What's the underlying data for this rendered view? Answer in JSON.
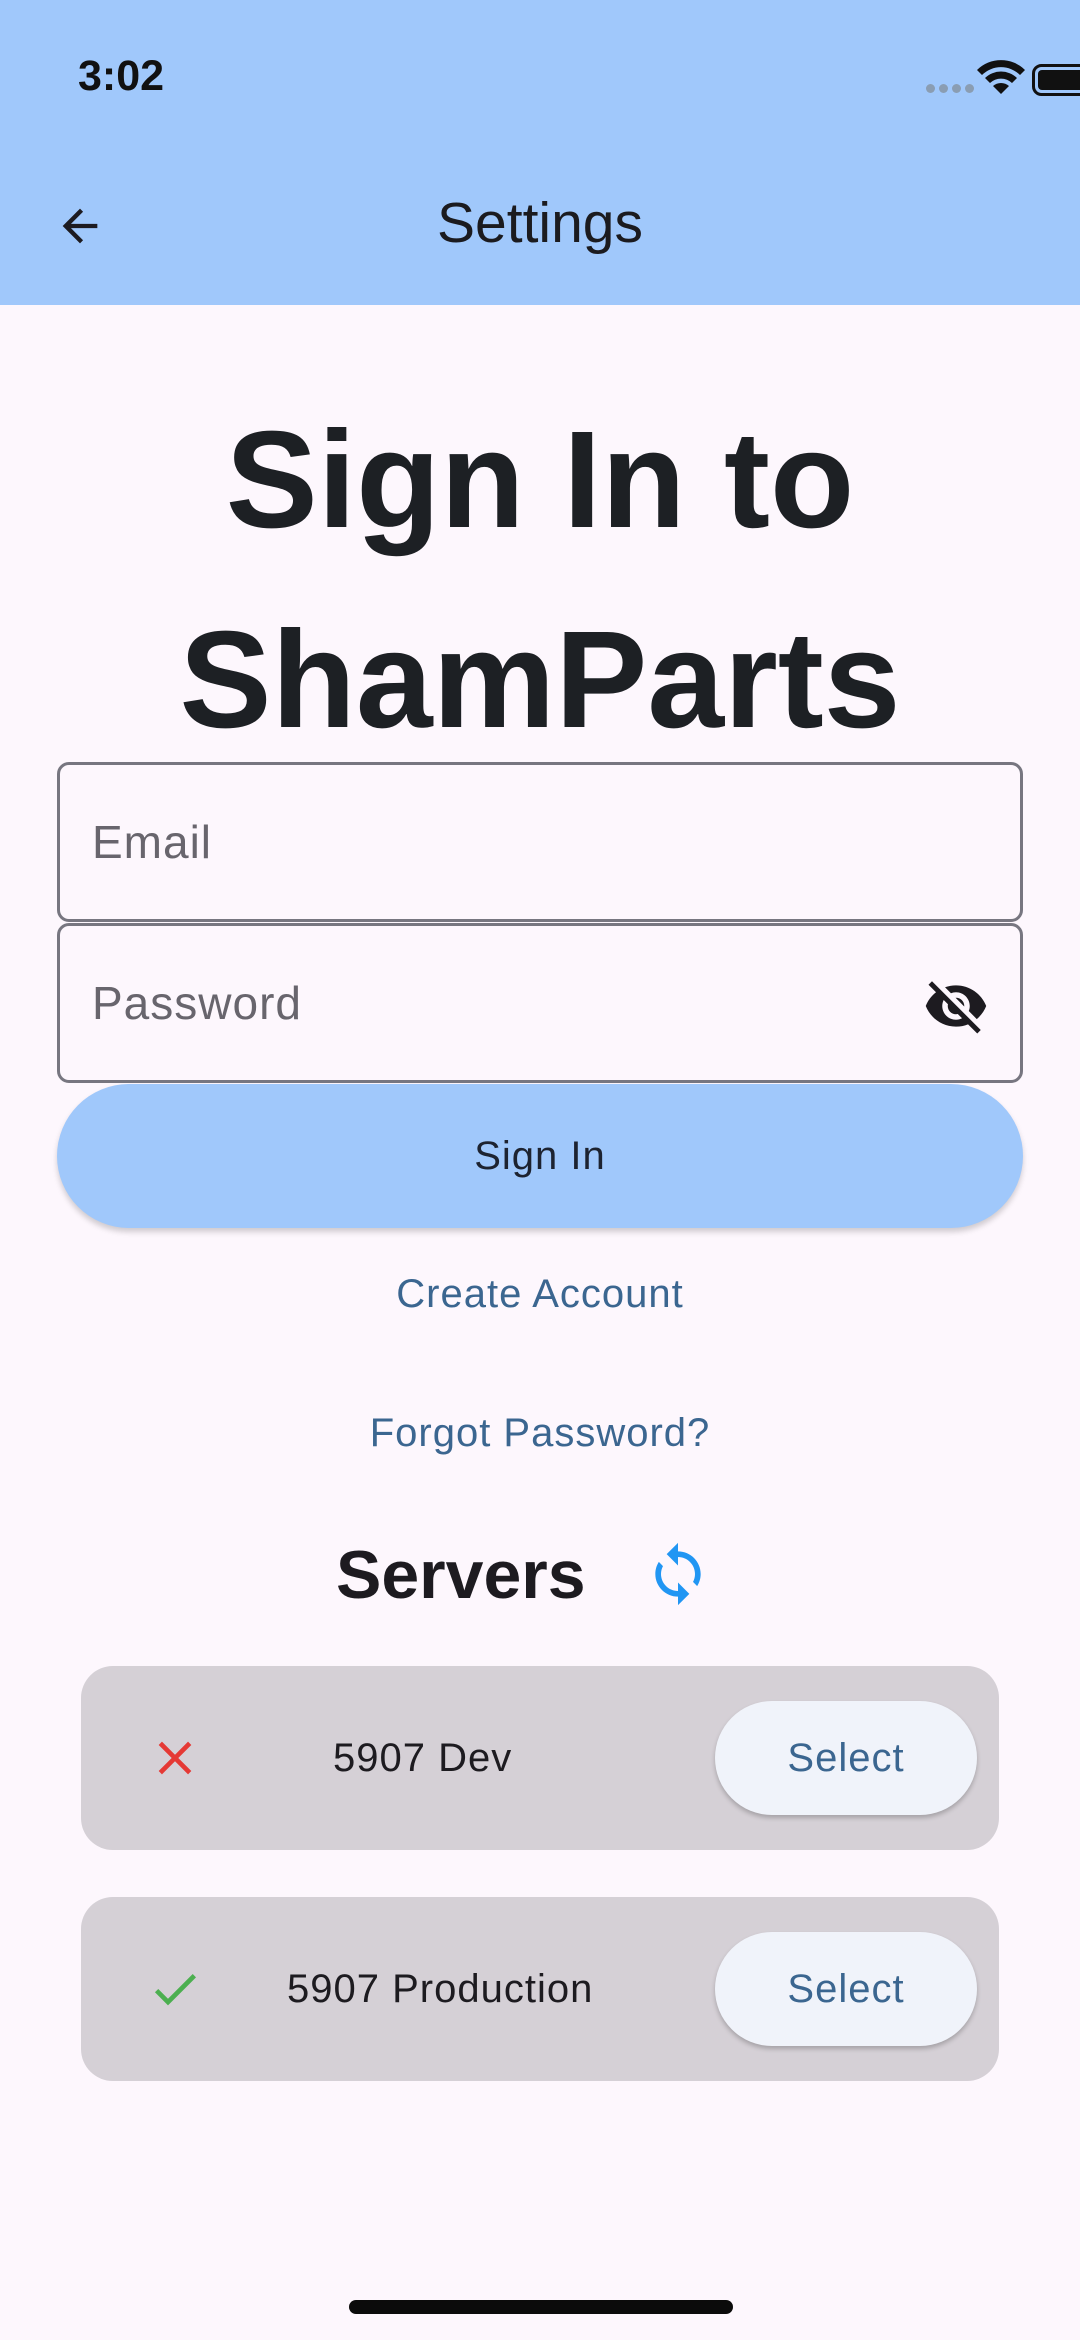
{
  "status_bar": {
    "time": "3:02"
  },
  "appbar": {
    "title": "Settings",
    "back_icon": "arrow-left-icon"
  },
  "heading": {
    "line1": "Sign In to",
    "line2": "ShamParts"
  },
  "form": {
    "email_placeholder": "Email",
    "email_value": "",
    "password_placeholder": "Password",
    "password_value": "",
    "visibility_icon": "eye-off-icon",
    "sign_in_label": "Sign In",
    "create_account_label": "Create Account",
    "forgot_password_label": "Forgot Password?"
  },
  "servers": {
    "title": "Servers",
    "refresh_icon": "refresh-icon",
    "items": [
      {
        "name": "5907 Dev",
        "status": "offline",
        "status_icon": "close-icon",
        "select_label": "Select"
      },
      {
        "name": "5907 Production",
        "status": "online",
        "status_icon": "check-icon",
        "select_label": "Select"
      }
    ]
  },
  "colors": {
    "app_bar": "#a0c8fb",
    "primary_button": "#a0c8fb",
    "link": "#3b6690",
    "background": "#fdf7fd",
    "card": "#d5d0d6",
    "error": "#e53935",
    "success": "#4caf50",
    "refresh": "#2196f3"
  }
}
